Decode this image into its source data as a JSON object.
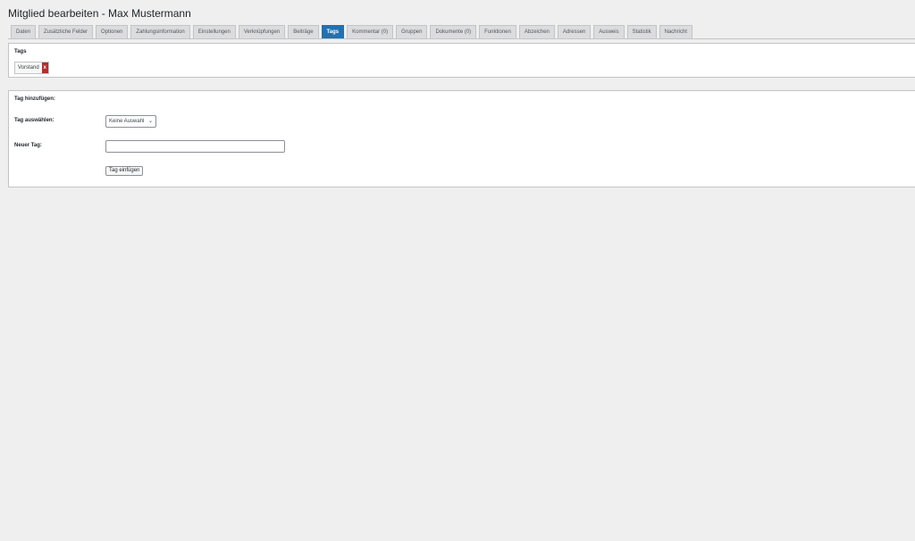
{
  "page": {
    "title": "Mitglied bearbeiten - Max Mustermann"
  },
  "tabs": [
    {
      "label": "Daten"
    },
    {
      "label": "Zusätzliche Felder"
    },
    {
      "label": "Optionen"
    },
    {
      "label": "Zahlungsinformation"
    },
    {
      "label": "Einstellungen"
    },
    {
      "label": "Verknüpfungen"
    },
    {
      "label": "Beiträge"
    },
    {
      "label": "Tags",
      "active": true
    },
    {
      "label": "Kommentar (0)"
    },
    {
      "label": "Gruppen"
    },
    {
      "label": "Dokumente (0)"
    },
    {
      "label": "Funktionen"
    },
    {
      "label": "Abzeichen"
    },
    {
      "label": "Adressen"
    },
    {
      "label": "Ausweis"
    },
    {
      "label": "Statistik"
    },
    {
      "label": "Nachricht"
    }
  ],
  "tags_panel": {
    "heading": "Tags",
    "tags": [
      {
        "label": "Vorstand",
        "remove_label": "x"
      }
    ]
  },
  "add_tag_panel": {
    "heading": "Tag hinzufügen:",
    "select_label": "Tag auswählen:",
    "select_value": "Keine Auswahl",
    "new_tag_label": "Neuer Tag:",
    "new_tag_value": "",
    "submit_label": "Tag einfügen"
  },
  "colors": {
    "accent": "#2271b1",
    "remove": "#b32d2e",
    "background": "#efefef"
  },
  "icons": {
    "select_chevron": "chevron-down-icon"
  }
}
